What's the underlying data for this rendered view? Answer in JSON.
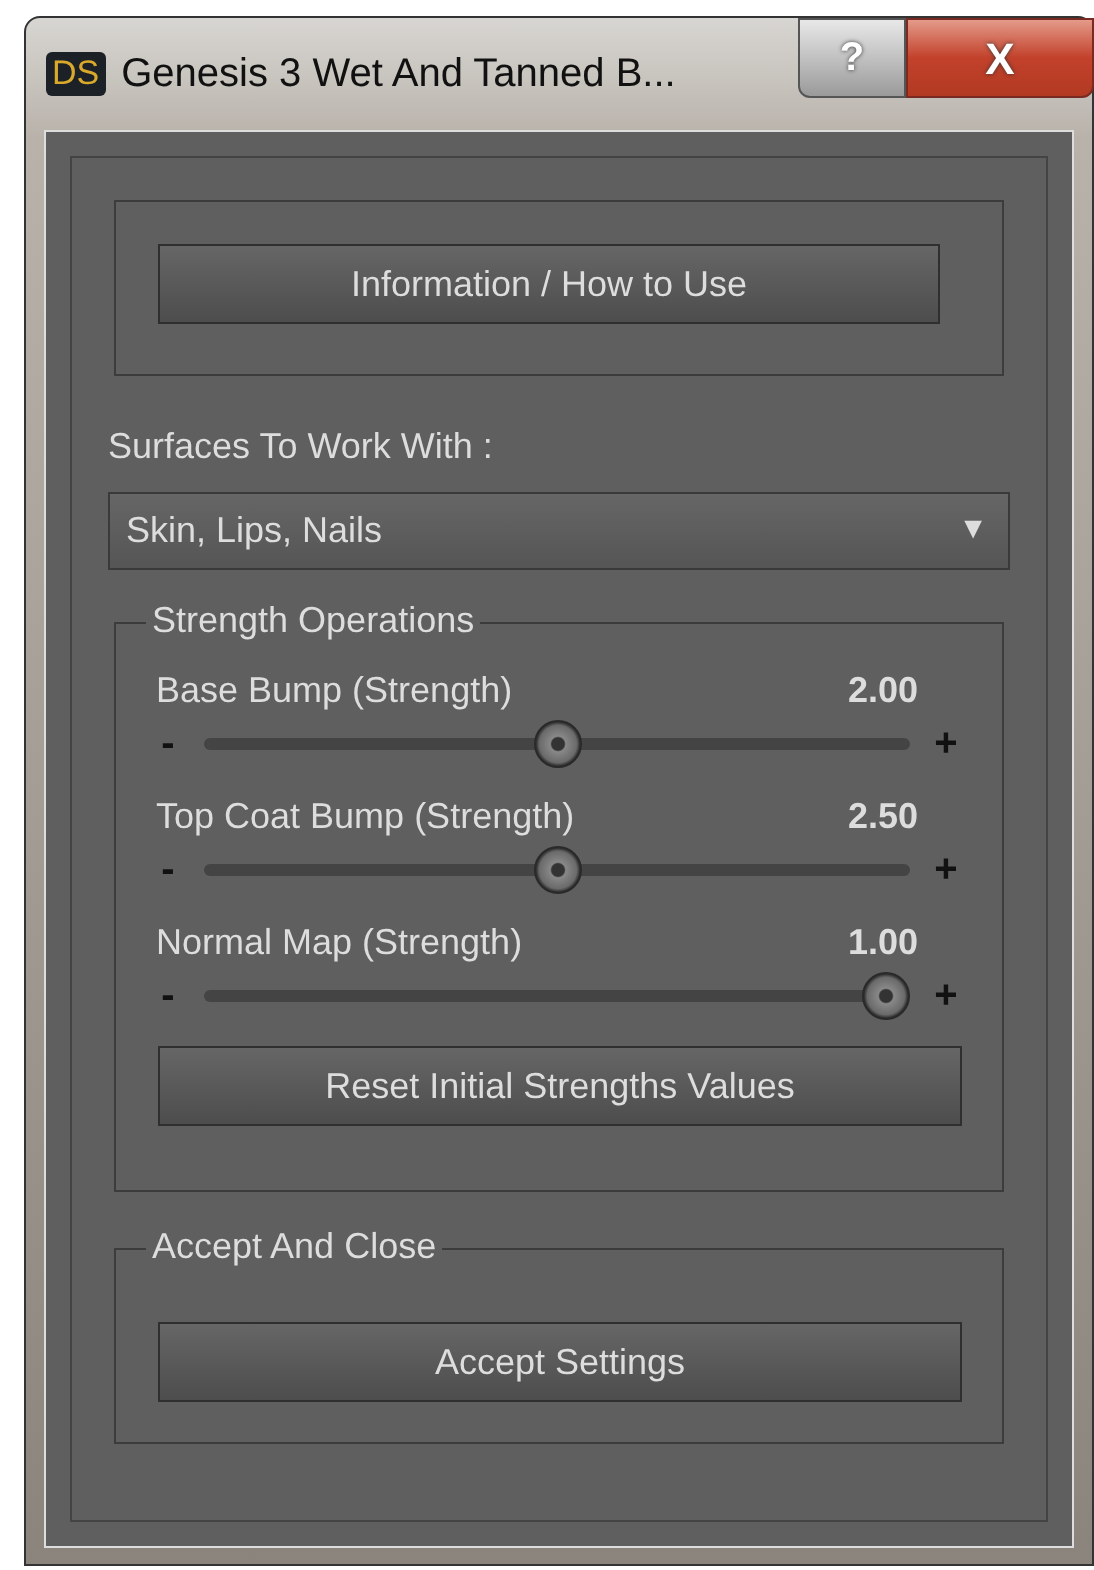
{
  "window": {
    "app_icon": "DS",
    "title": "Genesis 3 Wet And Tanned B...",
    "help_button": "?",
    "close_button": "X"
  },
  "info_button": "Information / How to Use",
  "surfaces": {
    "label": "Surfaces To Work With :",
    "value": "Skin, Lips, Nails",
    "arrow": "▼"
  },
  "strength": {
    "legend": "Strength Operations",
    "sliders": [
      {
        "name": "Base Bump (Strength)",
        "reading": "2.00",
        "level": 0.5,
        "minus": "-",
        "plus": "+"
      },
      {
        "name": "Top Coat Bump (Strength)",
        "reading": "2.50",
        "level": 0.5,
        "minus": "-",
        "plus": "+"
      },
      {
        "name": "Normal Map (Strength)",
        "reading": "1.00",
        "level": 1.0,
        "minus": "-",
        "plus": "+"
      }
    ],
    "reset_button": "Reset Initial Strengths Values"
  },
  "accept": {
    "legend": "Accept And Close",
    "button": "Accept Settings"
  }
}
